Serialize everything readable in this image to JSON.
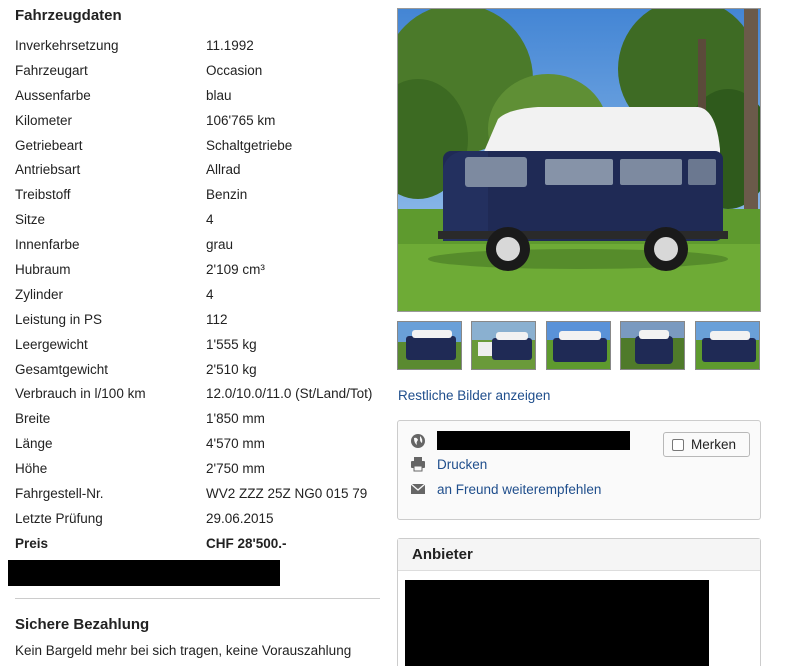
{
  "vehicle": {
    "section_title": "Fahrzeugdaten",
    "specs": [
      {
        "label": "Inverkehrsetzung",
        "value": "11.1992"
      },
      {
        "label": "Fahrzeugart",
        "value": "Occasion"
      },
      {
        "label": "Aussenfarbe",
        "value": "blau"
      },
      {
        "label": "Kilometer",
        "value": "106'765 km"
      },
      {
        "label": "Getriebeart",
        "value": "Schaltgetriebe"
      },
      {
        "label": "Antriebsart",
        "value": "Allrad"
      },
      {
        "label": "Treibstoff",
        "value": "Benzin"
      },
      {
        "label": "Sitze",
        "value": "4"
      },
      {
        "label": "Innenfarbe",
        "value": "grau"
      },
      {
        "label": "Hubraum",
        "value": "2'109 cm³"
      },
      {
        "label": "Zylinder",
        "value": "4"
      },
      {
        "label": "Leistung in PS",
        "value": "112"
      },
      {
        "label": "Leergewicht",
        "value": "1'555 kg"
      },
      {
        "label": "Gesamtgewicht",
        "value": "2'510 kg"
      },
      {
        "label": "Verbrauch in l/100 km",
        "value": "12.0/10.0/11.0 (St/Land/Tot)"
      },
      {
        "label": "Breite",
        "value": "1'850 mm"
      },
      {
        "label": "Länge",
        "value": "4'570 mm"
      },
      {
        "label": "Höhe",
        "value": "2'750 mm"
      },
      {
        "label": "Fahrgestell-Nr.",
        "value": "WV2 ZZZ 25Z NG0 015 79"
      },
      {
        "label": "Letzte Prüfung",
        "value": "29.06.2015"
      },
      {
        "label": "Preis",
        "value": "CHF 28'500.-"
      }
    ]
  },
  "payment": {
    "title": "Sichere Bezahlung",
    "text": "Kein Bargeld mehr bei sich tragen, keine Vorauszahlung"
  },
  "gallery": {
    "more_images_link": "Restliche Bilder anzeigen"
  },
  "actions": {
    "print_label": "Drucken",
    "recommend_label": "an Freund weiterempfehlen",
    "save_label": "Merken"
  },
  "seller": {
    "title": "Anbieter"
  },
  "colors": {
    "link": "#1f4e8c",
    "van_body": "#1f2a55",
    "van_roof": "#f2f2f2",
    "grass": "#5e9a2e",
    "sky": "#4f8fd8"
  }
}
